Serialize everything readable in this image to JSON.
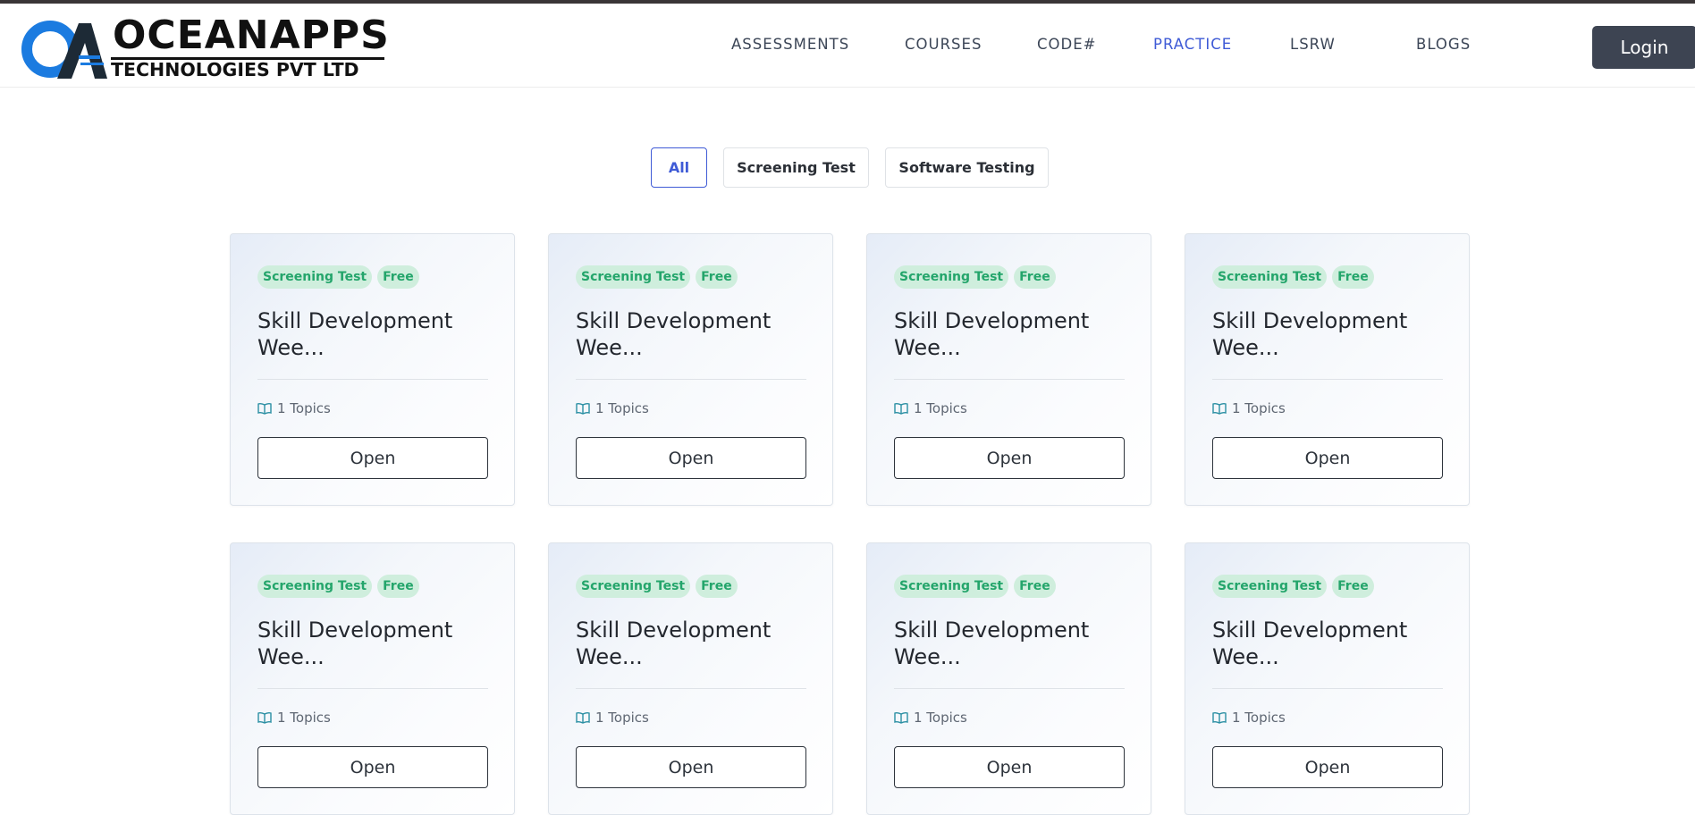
{
  "brand": {
    "line1": "OCEANAPPS",
    "line2": "TECHNOLOGIES PVT LTD",
    "logo_icon": "oa-logo-icon",
    "accent_color": "#1b7be0"
  },
  "nav": {
    "items": [
      {
        "label": "ASSESSMENTS",
        "active": false
      },
      {
        "label": "COURSES",
        "active": false
      },
      {
        "label": "CODE#",
        "active": false
      },
      {
        "label": "PRACTICE",
        "active": true
      },
      {
        "label": "LSRW",
        "active": false
      },
      {
        "label": "BLOGS",
        "active": false
      }
    ],
    "active_color": "#3f5bd6",
    "login_label": "Login"
  },
  "filters": {
    "items": [
      {
        "label": "All",
        "active": true
      },
      {
        "label": "Screening Test",
        "active": false
      },
      {
        "label": "Software Testing",
        "active": false
      }
    ]
  },
  "cards": [
    {
      "category": "Screening Test",
      "price": "Free",
      "title": "Skill Development Wee...",
      "topics": "1 Topics",
      "button": "Open"
    },
    {
      "category": "Screening Test",
      "price": "Free",
      "title": "Skill Development Wee...",
      "topics": "1 Topics",
      "button": "Open"
    },
    {
      "category": "Screening Test",
      "price": "Free",
      "title": "Skill Development Wee...",
      "topics": "1 Topics",
      "button": "Open"
    },
    {
      "category": "Screening Test",
      "price": "Free",
      "title": "Skill Development Wee...",
      "topics": "1 Topics",
      "button": "Open"
    },
    {
      "category": "Screening Test",
      "price": "Free",
      "title": "Skill Development Wee...",
      "topics": "1 Topics",
      "button": "Open"
    },
    {
      "category": "Screening Test",
      "price": "Free",
      "title": "Skill Development Wee...",
      "topics": "1 Topics",
      "button": "Open"
    },
    {
      "category": "Screening Test",
      "price": "Free",
      "title": "Skill Development Wee...",
      "topics": "1 Topics",
      "button": "Open"
    },
    {
      "category": "Screening Test",
      "price": "Free",
      "title": "Skill Development Wee...",
      "topics": "1 Topics",
      "button": "Open"
    }
  ],
  "colors": {
    "badge_bg": "#cfeedd",
    "badge_text": "#24a56b",
    "topics_icon": "#2a8fa3"
  }
}
